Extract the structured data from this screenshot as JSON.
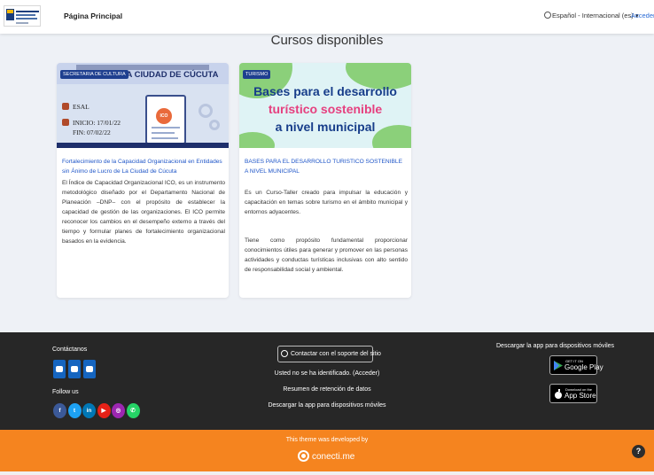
{
  "navbar": {
    "home_label": "Página Principal",
    "language_label": "Español - Internacional (es)",
    "login_label": "Acceder"
  },
  "section_title": "Cursos disponibles",
  "courses": [
    {
      "image": {
        "badge": "SECRETARIA DE CULTURA",
        "banner_text": "RO DE LA CIUDAD DE CÚCUTA",
        "info_1": "ESAL",
        "info_2": "INICIO: 17/01/22",
        "info_3": "FIN: 07/02/22",
        "seal": "ICO"
      },
      "title": "Fortalecimiento de la Capacidad Organizacional en Entidades sin Ánimo de Lucro de La Ciudad de Cúcuta",
      "description": "El Índice de Capacidad Organizacional ICO, es un instrumento metodológico diseñado por el Departamento Nacional de Planeación –DNP– con el propósito de establecer la capacidad de gestión de las organizaciones. El ICO permite reconocer los cambios en el desempeño externo a través del tiempo y formular planes de fortalecimiento organizacional basados en la evidencia."
    },
    {
      "image": {
        "badge": "TURISMO",
        "line_1": "Bases para el desarrollo",
        "line_2": "turístico sostenible",
        "line_3": "a nivel municipal"
      },
      "title": "BASES PARA EL DESARROLLO TURISTICO SOSTENIBLE A NIVEL MUNICIPAL",
      "description": "Es un Curso-Taller creado para impulsar la educación y capacitación en temas sobre turismo en el ámbito municipal y entornos adyacentes.",
      "description_2": "Tiene como propósito fundamental proporcionar conocimientos útiles para generar y promover en las personas actividades y conductas turísticas inclusivas con alto sentido de responsabilidad social y ambiental."
    }
  ],
  "footer": {
    "contact_title": "Contáctanos",
    "follow_title": "Follow us",
    "contact_icons": [
      "location-icon",
      "phone-icon",
      "mail-icon"
    ],
    "social": [
      {
        "icon": "facebook-icon",
        "glyph": "f",
        "color": "#3b5998"
      },
      {
        "icon": "twitter-icon",
        "glyph": "t",
        "color": "#1da1f2"
      },
      {
        "icon": "linkedin-icon",
        "glyph": "in",
        "color": "#0077b5"
      },
      {
        "icon": "youtube-icon",
        "glyph": "▶",
        "color": "#e62117"
      },
      {
        "icon": "instagram-icon",
        "glyph": "◎",
        "color": "#9c27b0"
      },
      {
        "icon": "whatsapp-icon",
        "glyph": "✆",
        "color": "#25d366"
      }
    ],
    "support_button": "Contactar con el soporte del sitio",
    "not_logged": "Usted no se ha identificado. (Acceder)",
    "data_retention": "Resumen de retención de datos",
    "mobile_app": "Descargar la app para dispositivos móviles",
    "apps_title": "Descargar la app para dispositivos móviles",
    "google_play_small": "GET IT ON",
    "google_play": "Google Play",
    "app_store_small": "Download on the",
    "app_store": "App Store"
  },
  "credits": {
    "developed_by": "This theme was developed by",
    "brand": "conecti.me"
  },
  "help_label": "?",
  "colors": {
    "accent_blue": "#1e55c8",
    "footer_bg": "#272727",
    "orange": "#f5841f"
  }
}
